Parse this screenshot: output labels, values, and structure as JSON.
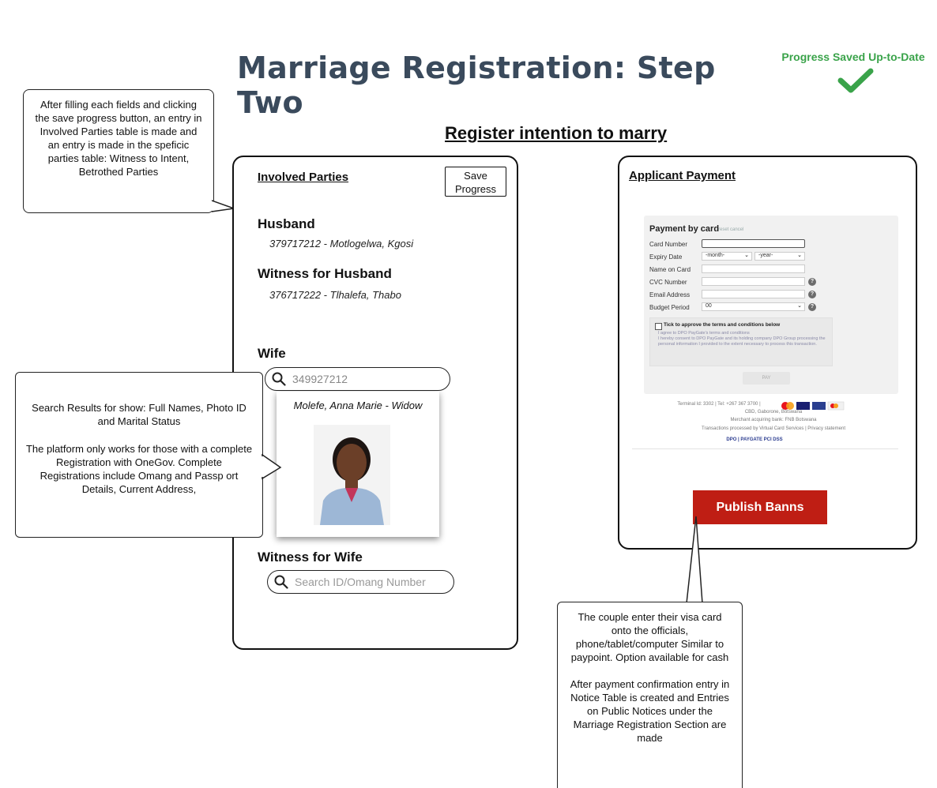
{
  "header": {
    "title": "Marriage Registration: Step Two",
    "status": "Progress Saved Up-to-Date",
    "subtitle": "Register intention to marry"
  },
  "involved": {
    "heading": "Involved Parties",
    "save_label_1": "Save",
    "save_label_2": "Progress",
    "husband_label": "Husband",
    "husband_value": "379717212 - Motlogelwa, Kgosi",
    "witness_husband_label": "Witness for Husband",
    "witness_husband_value": "376717222 - Tlhalefa, Thabo",
    "wife_label": "Wife",
    "wife_search_value": "349927212",
    "wife_result": "Molefe, Anna Marie - Widow",
    "witness_wife_label": "Witness for Wife",
    "witness_wife_placeholder": "Search ID/Omang Number"
  },
  "payment": {
    "heading": "Applicant Payment",
    "card_title": "Payment by card",
    "card_links": "reset  cancel",
    "fields": {
      "card_number": "Card Number",
      "expiry": "Expiry Date",
      "month": "-month-",
      "year": "-year-",
      "name": "Name on Card",
      "cvc": "CVC Number",
      "email": "Email Address",
      "budget": "Budget Period",
      "budget_value": "00"
    },
    "terms_title": "Tick to approve the terms and conditions below",
    "terms_1": "I agree to DPO PayGate's terms and conditions",
    "terms_2": "I hereby consent to DPO PayGate and its holding company DPO Group processing the personal information I provided to the extent necessary to process this transaction.",
    "pay_label": "PAY",
    "footer_1": "Terminal Id: 3302 | Tel: +267 367 3700 |",
    "footer_2": "CBD, Gaborone, Botswana",
    "footer_3": "Merchant acquiring bank: FNB Botswana",
    "footer_4": "Transactions processed by Virtual Card Services | Privacy statement",
    "footer_5": "DPO | PAYGATE   PCI DSS",
    "publish_label": "Publish Banns"
  },
  "callouts": {
    "save_note": "After filling each fields and clicking the save progress button, an entry in Involved Parties table is made and an entry is made in the speficic parties table: Witness to Intent, Betrothed Parties",
    "search_note_1": "Search Results for show: Full Names, Photo ID and Marital Status",
    "search_note_2": "The platform only works for those with a complete Registration with OneGov. Complete Registrations include Omang and Passp ort Details, Current Address,",
    "payment_note_1": "The couple enter their visa card onto the officials, phone/tablet/computer Similar to paypoint. Option available for cash",
    "payment_note_2": "After payment confirmation entry in Notice Table is created and Entries on Public Notices under the Marriage Registration Section are made"
  },
  "colors": {
    "title": "#3a4a5c",
    "saved_green": "#3aa34a",
    "publish_red": "#bf1e14"
  }
}
